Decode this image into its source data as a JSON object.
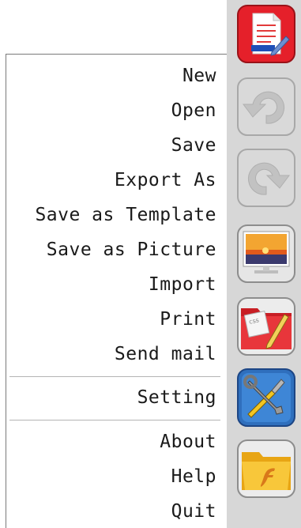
{
  "menu": {
    "items": [
      {
        "id": "new",
        "label": "New"
      },
      {
        "id": "open",
        "label": "Open"
      },
      {
        "id": "save",
        "label": "Save"
      },
      {
        "id": "export-as",
        "label": "Export As"
      },
      {
        "id": "save-as-template",
        "label": "Save as Template"
      },
      {
        "id": "save-as-picture",
        "label": "Save as Picture"
      },
      {
        "id": "import",
        "label": "Import"
      },
      {
        "id": "print",
        "label": "Print"
      },
      {
        "id": "send-mail",
        "label": "Send mail"
      },
      {
        "id": "setting",
        "label": "Setting"
      },
      {
        "id": "about",
        "label": "About"
      },
      {
        "id": "help",
        "label": "Help"
      },
      {
        "id": "quit",
        "label": "Quit"
      }
    ]
  },
  "toolbar": {
    "buttons": [
      {
        "icon": "document-edit-icon",
        "color": "#e8202a",
        "enabled": true
      },
      {
        "icon": "undo-icon",
        "color": "#c9c9c9",
        "enabled": false
      },
      {
        "icon": "redo-icon",
        "color": "#c9c9c9",
        "enabled": false
      },
      {
        "icon": "picture-icon",
        "color": "#f0a020",
        "enabled": true
      },
      {
        "icon": "css-folder-icon",
        "color": "#d9262c",
        "enabled": true
      },
      {
        "icon": "tools-icon",
        "color": "#2d6fb8",
        "enabled": true
      },
      {
        "icon": "flash-folder-icon",
        "color": "#f2b81c",
        "enabled": true
      }
    ]
  }
}
